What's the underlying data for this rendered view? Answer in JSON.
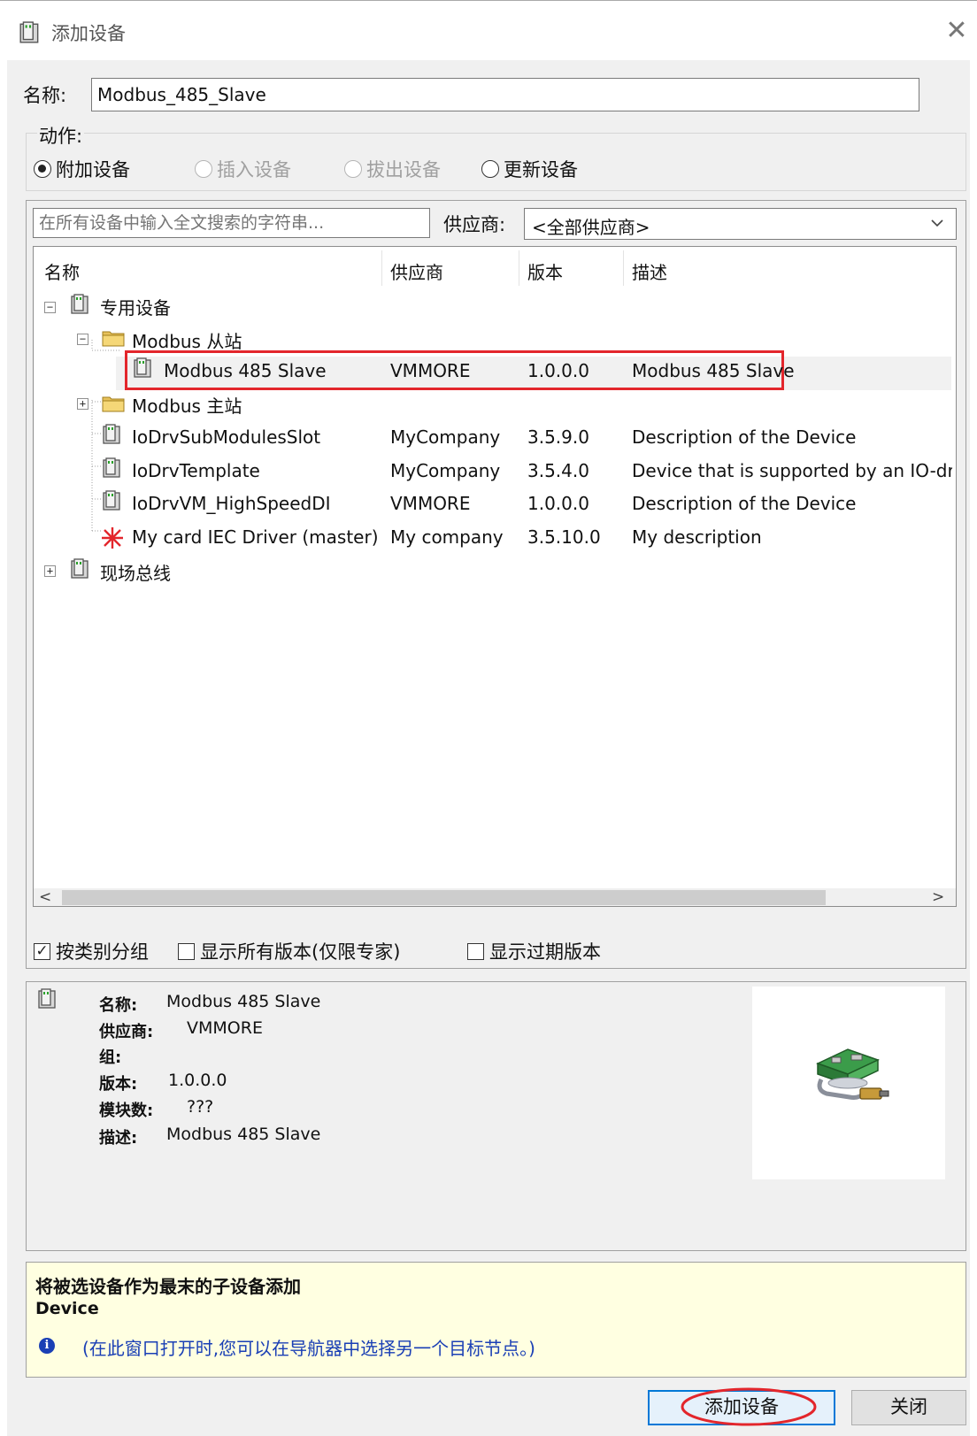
{
  "window": {
    "title": "添加设备",
    "close_glyph": "✕"
  },
  "name_field": {
    "label": "名称:",
    "value": "Modbus_485_Slave"
  },
  "action": {
    "label": "动作:",
    "options": [
      {
        "label": "附加设备",
        "state": "checked"
      },
      {
        "label": "插入设备",
        "state": "disabled"
      },
      {
        "label": "拔出设备",
        "state": "disabled"
      },
      {
        "label": "更新设备",
        "state": "unchecked"
      }
    ]
  },
  "search": {
    "placeholder": "在所有设备中输入全文搜索的字符串...",
    "vendor_label": "供应商:",
    "vendor_value": "<全部供应商>"
  },
  "columns": [
    "名称",
    "供应商",
    "版本",
    "描述"
  ],
  "tree": {
    "dedicated": {
      "label": "专用设备",
      "expander": "−"
    },
    "modbus_slave_folder": {
      "label": "Modbus 从站",
      "expander": "−"
    },
    "modbus_master_folder": {
      "label": "Modbus 主站",
      "expander": "+"
    },
    "fieldbus": {
      "label": "现场总线",
      "expander": "+"
    },
    "rows": [
      {
        "name": "Modbus 485 Slave",
        "vendor": "VMMORE",
        "version": "1.0.0.0",
        "description": "Modbus 485 Slave"
      },
      {
        "name": "IoDrvSubModulesSlot",
        "vendor": "MyCompany",
        "version": "3.5.9.0",
        "description": "Description of the Device"
      },
      {
        "name": "IoDrvTemplate",
        "vendor": "MyCompany",
        "version": "3.5.4.0",
        "description": "Device that is supported by an IO-driver w"
      },
      {
        "name": "IoDrvVM_HighSpeedDI",
        "vendor": "VMMORE",
        "version": "1.0.0.0",
        "description": "Description of the Device"
      },
      {
        "name": "My card IEC Driver (master)",
        "vendor": "My company",
        "version": "3.5.10.0",
        "description": "My description"
      }
    ]
  },
  "scrollbar": {
    "left": "<",
    "right": ">"
  },
  "checkboxes": [
    {
      "label": "按类别分组",
      "checked": true,
      "mark": "✓"
    },
    {
      "label": "显示所有版本(仅限专家)",
      "checked": false,
      "mark": ""
    },
    {
      "label": "显示过期版本",
      "checked": false,
      "mark": ""
    }
  ],
  "details": {
    "name_label": "名称:",
    "name_value": "Modbus 485 Slave",
    "vendor_label": "供应商:",
    "vendor_value": "VMMORE",
    "group_label": "组:",
    "version_label": "版本:",
    "version_value": "1.0.0.0",
    "modules_label": "模块数:",
    "modules_value": "???",
    "desc_label": "描述:",
    "desc_value": "Modbus 485 Slave"
  },
  "info": {
    "title": "将被选设备作为最末的子设备添加",
    "subtitle": "Device",
    "icon": "i",
    "note": "(在此窗口打开时,您可以在导航器中选择另一个目标节点。)"
  },
  "buttons": {
    "add": "添加设备",
    "close": "关闭"
  },
  "colors": {
    "highlight_red": "#e3262c",
    "accent_blue": "#0078d7",
    "info_bg": "#ffffe1"
  }
}
